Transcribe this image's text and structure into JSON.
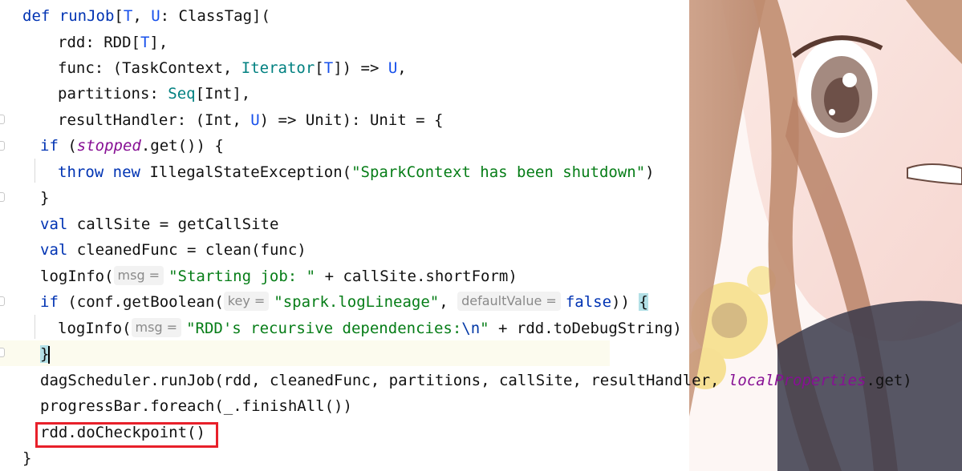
{
  "code": {
    "l1": {
      "kw": "def",
      "name": "runJob",
      "lb": "[",
      "T": "T",
      "comma": ", ",
      "U": "U",
      "rest": ": ClassTag]("
    },
    "l2": {
      "a": "rdd: RDD[",
      "T": "T",
      "b": "],"
    },
    "l3": {
      "a": "func: (TaskContext, ",
      "iter": "Iterator",
      "b": "[",
      "T": "T",
      "c": "]) => ",
      "U": "U",
      "d": ","
    },
    "l4": {
      "a": "partitions: ",
      "seq": "Seq",
      "b": "[Int],"
    },
    "l5": {
      "a": "resultHandler: (Int, ",
      "U": "U",
      "b": ") => Unit): Unit = {"
    },
    "l6": {
      "kw": "if",
      "a": " (",
      "fld": "stopped",
      "b": ".get()) {"
    },
    "l7": {
      "kw1": "throw",
      "kw2": "new",
      "a": "IllegalStateException(",
      "str": "\"SparkContext has been shutdown\"",
      "b": ")"
    },
    "l8": {
      "a": "}"
    },
    "l9": {
      "kw": "val",
      "a": " callSite = getCallSite"
    },
    "l10": {
      "kw": "val",
      "a": " cleanedFunc = clean(func)"
    },
    "l11": {
      "a": "logInfo(",
      "hint": "msg =",
      "str": "\"Starting job: \"",
      "b": " + callSite.shortForm)"
    },
    "l12": {
      "kw": "if",
      "a": " (conf.getBoolean(",
      "hint1": "key =",
      "str": "\"spark.logLineage\"",
      "b": ", ",
      "hint2": "defaultValue =",
      "kw2": "false",
      "c": ")) ",
      "brace": "{"
    },
    "l13": {
      "a": "logInfo(",
      "hint": "msg =",
      "str1": "\"RDD's recursive dependencies:",
      "esc": "\\n",
      "str2": "\"",
      "b": " + rdd.toDebugString)"
    },
    "l14": {
      "brace": "}"
    },
    "l15": {
      "a": "dagScheduler.runJob(rdd, cleanedFunc, partitions, callSite, resultHandler, ",
      "fld": "localProperties",
      "b": ".get)"
    },
    "l16": {
      "a": "progressBar.foreach(_.finishAll())"
    },
    "l17": {
      "a": "rdd.doCheckpoint()"
    },
    "l18": {
      "a": "}"
    }
  }
}
